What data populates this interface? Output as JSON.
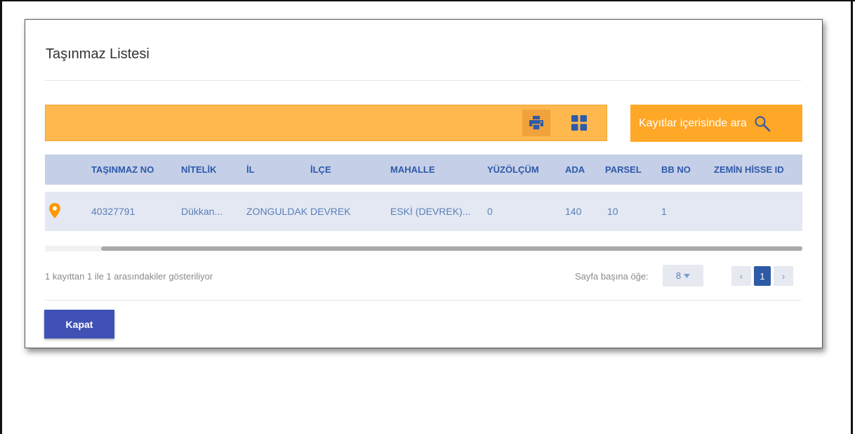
{
  "dialog": {
    "title": "Taşınmaz Listesi"
  },
  "toolbar": {
    "print_icon": "printer-icon",
    "grid_icon": "grid-view-icon",
    "search_label": "Kayıtlar içerisinde ara",
    "search_icon": "search-icon"
  },
  "table": {
    "columns": [
      "TAŞINMAZ NO",
      "NİTELİK",
      "İL",
      "İLÇE",
      "MAHALLE",
      "YÜZÖLÇÜM",
      "ADA",
      "PARSEL",
      "BB NO",
      "ZEMİN HİSSE ID"
    ],
    "rows": [
      {
        "icon": "location-pin-icon",
        "cells": [
          "40327791",
          "Dükkan...",
          "ZONGULDAK",
          "DEVREK",
          "ESKİ (DEVREK)...",
          "0",
          "140",
          "10",
          "1",
          ""
        ]
      }
    ]
  },
  "pagination": {
    "info": "1 kayıttan 1 ile 1 arasındakiler gösteriliyor",
    "per_page_label": "Sayfa başına öğe:",
    "per_page_value": "8",
    "prev": "‹",
    "current_page": "1",
    "next": "›"
  },
  "actions": {
    "close_label": "Kapat"
  },
  "colors": {
    "toolbar": "#ffb84d",
    "search_button": "#ffa726",
    "header_row": "#c5cfe8",
    "data_row": "#e3e8f3",
    "primary": "#3f51b5",
    "pin": "#ff9800"
  }
}
